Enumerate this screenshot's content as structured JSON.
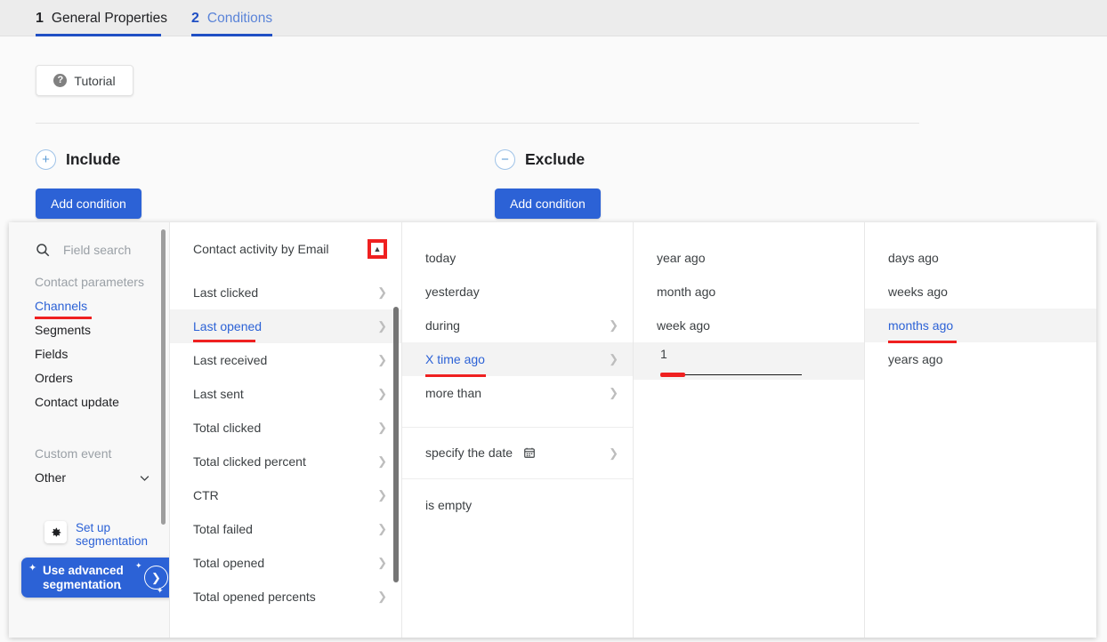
{
  "tabs": [
    {
      "num": "1",
      "label": "General Properties",
      "active": true
    },
    {
      "num": "2",
      "label": "Conditions",
      "active": false
    }
  ],
  "tutorial": {
    "label": "Tutorial",
    "icon": "question-mark-icon"
  },
  "groups": {
    "include": {
      "title": "Include",
      "sign": "+",
      "button": "Add condition"
    },
    "exclude": {
      "title": "Exclude",
      "sign": "−",
      "button": "Add condition"
    }
  },
  "sidebar": {
    "search_placeholder": "Field search",
    "section_contact": "Contact parameters",
    "items": [
      {
        "label": "Channels",
        "active": true,
        "underlined": true
      },
      {
        "label": "Segments",
        "active": false,
        "underlined": false
      },
      {
        "label": "Fields",
        "active": false,
        "underlined": false
      },
      {
        "label": "Orders",
        "active": false,
        "underlined": false
      },
      {
        "label": "Contact update",
        "active": false,
        "underlined": false
      }
    ],
    "section_custom": "Custom event",
    "other": "Other",
    "setup": "Set up segmentation",
    "advanced": "Use advanced segmentation"
  },
  "metrics": {
    "header": "Contact activity by Email",
    "items": [
      {
        "label": "Last clicked",
        "chev": true,
        "sel": false
      },
      {
        "label": "Last opened",
        "chev": true,
        "sel": true,
        "underlined": true
      },
      {
        "label": "Last received",
        "chev": true,
        "sel": false
      },
      {
        "label": "Last sent",
        "chev": true,
        "sel": false
      },
      {
        "label": "Total clicked",
        "chev": true,
        "sel": false
      },
      {
        "label": "Total clicked percent",
        "chev": true,
        "sel": false
      },
      {
        "label": "CTR",
        "chev": true,
        "sel": false
      },
      {
        "label": "Total failed",
        "chev": true,
        "sel": false
      },
      {
        "label": "Total opened",
        "chev": true,
        "sel": false
      },
      {
        "label": "Total opened percents",
        "chev": true,
        "sel": false
      }
    ]
  },
  "when": {
    "items": [
      {
        "label": "today",
        "chev": false,
        "sel": false
      },
      {
        "label": "yesterday",
        "chev": false,
        "sel": false
      },
      {
        "label": "during",
        "chev": true,
        "sel": false
      },
      {
        "label": "X time ago",
        "chev": true,
        "sel": true,
        "underlined": true
      },
      {
        "label": "more than",
        "chev": true,
        "sel": false
      },
      {
        "label": "specify the date",
        "chev": true,
        "sel": false,
        "calendar": true,
        "sep": true
      },
      {
        "label": "is empty",
        "chev": false,
        "sel": false,
        "sep": true
      }
    ]
  },
  "unit_singular": {
    "items": [
      {
        "label": "year ago",
        "chev": false,
        "sel": false
      },
      {
        "label": "month ago",
        "chev": false,
        "sel": false
      },
      {
        "label": "week ago",
        "chev": false,
        "sel": false
      }
    ],
    "input_value": "1"
  },
  "unit_plural": {
    "items": [
      {
        "label": "days ago",
        "chev": false,
        "sel": false
      },
      {
        "label": "weeks ago",
        "chev": false,
        "sel": false
      },
      {
        "label": "months ago",
        "chev": false,
        "sel": true,
        "underlined": true
      },
      {
        "label": "years ago",
        "chev": false,
        "sel": false
      }
    ]
  },
  "colors": {
    "accent_blue": "#2c62d6",
    "highlight_red": "#ef2020",
    "tab_bar_bg": "#ececec",
    "row_selected_bg": "#f3f3f3"
  }
}
